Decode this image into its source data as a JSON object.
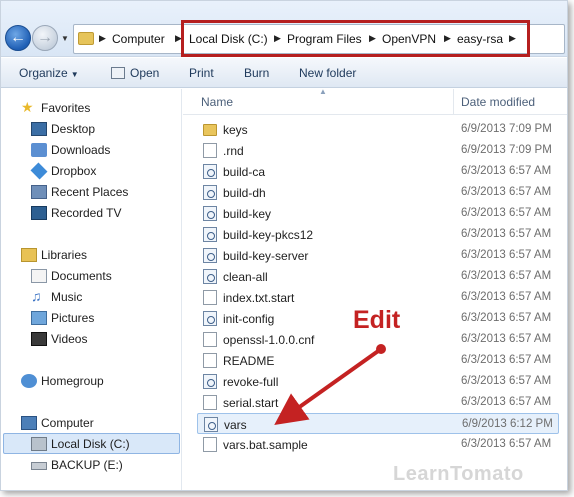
{
  "address": {
    "crumbs": [
      "Computer",
      "Local Disk (C:)",
      "Program Files",
      "OpenVPN",
      "easy-rsa"
    ]
  },
  "toolbar": {
    "organize": "Organize",
    "open": "Open",
    "print": "Print",
    "burn": "Burn",
    "new_folder": "New folder"
  },
  "nav": {
    "favorites": "Favorites",
    "desktop": "Desktop",
    "downloads": "Downloads",
    "dropbox": "Dropbox",
    "recent_places": "Recent Places",
    "recorded_tv": "Recorded TV",
    "libraries": "Libraries",
    "documents": "Documents",
    "music": "Music",
    "pictures": "Pictures",
    "videos": "Videos",
    "homegroup": "Homegroup",
    "computer": "Computer",
    "local_disk": "Local Disk (C:)",
    "backup": "BACKUP (E:)"
  },
  "columns": {
    "name": "Name",
    "date_modified": "Date modified"
  },
  "files": [
    {
      "name": "keys",
      "date": "6/9/2013 7:09 PM",
      "icon": "folder-icon"
    },
    {
      "name": ".rnd",
      "date": "6/9/2013 7:09 PM",
      "icon": "file-icon"
    },
    {
      "name": "build-ca",
      "date": "6/3/2013 6:57 AM",
      "icon": "script-icon"
    },
    {
      "name": "build-dh",
      "date": "6/3/2013 6:57 AM",
      "icon": "script-icon"
    },
    {
      "name": "build-key",
      "date": "6/3/2013 6:57 AM",
      "icon": "script-icon"
    },
    {
      "name": "build-key-pkcs12",
      "date": "6/3/2013 6:57 AM",
      "icon": "script-icon"
    },
    {
      "name": "build-key-server",
      "date": "6/3/2013 6:57 AM",
      "icon": "script-icon"
    },
    {
      "name": "clean-all",
      "date": "6/3/2013 6:57 AM",
      "icon": "script-icon"
    },
    {
      "name": "index.txt.start",
      "date": "6/3/2013 6:57 AM",
      "icon": "file-icon"
    },
    {
      "name": "init-config",
      "date": "6/3/2013 6:57 AM",
      "icon": "script-icon"
    },
    {
      "name": "openssl-1.0.0.cnf",
      "date": "6/3/2013 6:57 AM",
      "icon": "file-icon"
    },
    {
      "name": "README",
      "date": "6/3/2013 6:57 AM",
      "icon": "file-icon"
    },
    {
      "name": "revoke-full",
      "date": "6/3/2013 6:57 AM",
      "icon": "script-icon"
    },
    {
      "name": "serial.start",
      "date": "6/3/2013 6:57 AM",
      "icon": "file-icon"
    },
    {
      "name": "vars",
      "date": "6/9/2013 6:12 PM",
      "icon": "script-icon"
    },
    {
      "name": "vars.bat.sample",
      "date": "6/3/2013 6:57 AM",
      "icon": "file-icon"
    }
  ],
  "annotation": {
    "edit_label": "Edit",
    "color": "#c42222"
  },
  "watermark": "LearnTomato",
  "colors": {
    "highlight_box": "#b51f1f",
    "selection": "#d9e8f9"
  }
}
